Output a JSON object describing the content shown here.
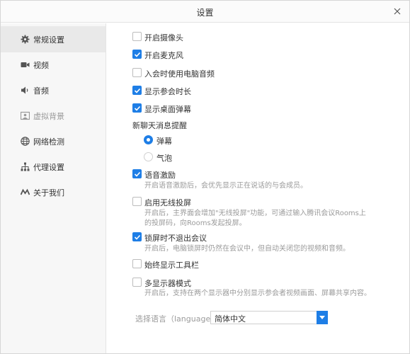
{
  "window": {
    "title": "设置"
  },
  "sidebar": {
    "items": [
      {
        "label": "常规设置",
        "icon": "gear-icon",
        "active": true
      },
      {
        "label": "视频",
        "icon": "video-camera-icon"
      },
      {
        "label": "音频",
        "icon": "speaker-icon"
      },
      {
        "label": "虚拟背景",
        "icon": "virtual-background-icon",
        "disabled": true
      },
      {
        "label": "网络检测",
        "icon": "globe-icon"
      },
      {
        "label": "代理设置",
        "icon": "network-tree-icon"
      },
      {
        "label": "关于我们",
        "icon": "about-logo-icon"
      }
    ]
  },
  "settings": {
    "camera": {
      "label": "开启摄像头",
      "checked": false
    },
    "mic": {
      "label": "开启麦克风",
      "checked": true
    },
    "pc_audio": {
      "label": "入会时使用电脑音频",
      "checked": false
    },
    "show_duration": {
      "label": "显示参会时长",
      "checked": true
    },
    "desktop_danmaku": {
      "label": "显示桌面弹幕",
      "checked": true
    },
    "chat_reminder": {
      "label": "新聊天消息提醒",
      "options": [
        {
          "label": "弹幕",
          "selected": true
        },
        {
          "label": "气泡",
          "selected": false
        }
      ]
    },
    "voice_excitation": {
      "label": "语音激励",
      "checked": true,
      "desc": "开启语音激励后，会优先显示正在说话的与会成员。"
    },
    "wireless_screen": {
      "label": "启用无线投屏",
      "checked": false,
      "desc_line1": "开启后，主界面会增加\"无线投屏\"功能，可通过输入腾讯会议Rooms上",
      "desc_line2": "的投屏码，向Rooms发起投屏。"
    },
    "lock_screen": {
      "label": "锁屏时不退出会议",
      "checked": true,
      "desc": "开启后，电脑锁屏时仍然在会议中，但自动关闭您的视频和音频。"
    },
    "always_toolbar": {
      "label": "始终显示工具栏",
      "checked": false
    },
    "multi_display": {
      "label": "多显示器模式",
      "checked": false,
      "desc": "开启后，支持在两个显示器中分别显示参会者视频画面、屏幕共享内容。"
    },
    "language": {
      "label": "选择语言（language）",
      "value": "简体中文"
    }
  },
  "colors": {
    "accent": "#1e7ee6",
    "sidebar_bg": "#f7f7f7",
    "sidebar_active": "#e9e9e9",
    "muted_text": "#9b9b9b"
  }
}
